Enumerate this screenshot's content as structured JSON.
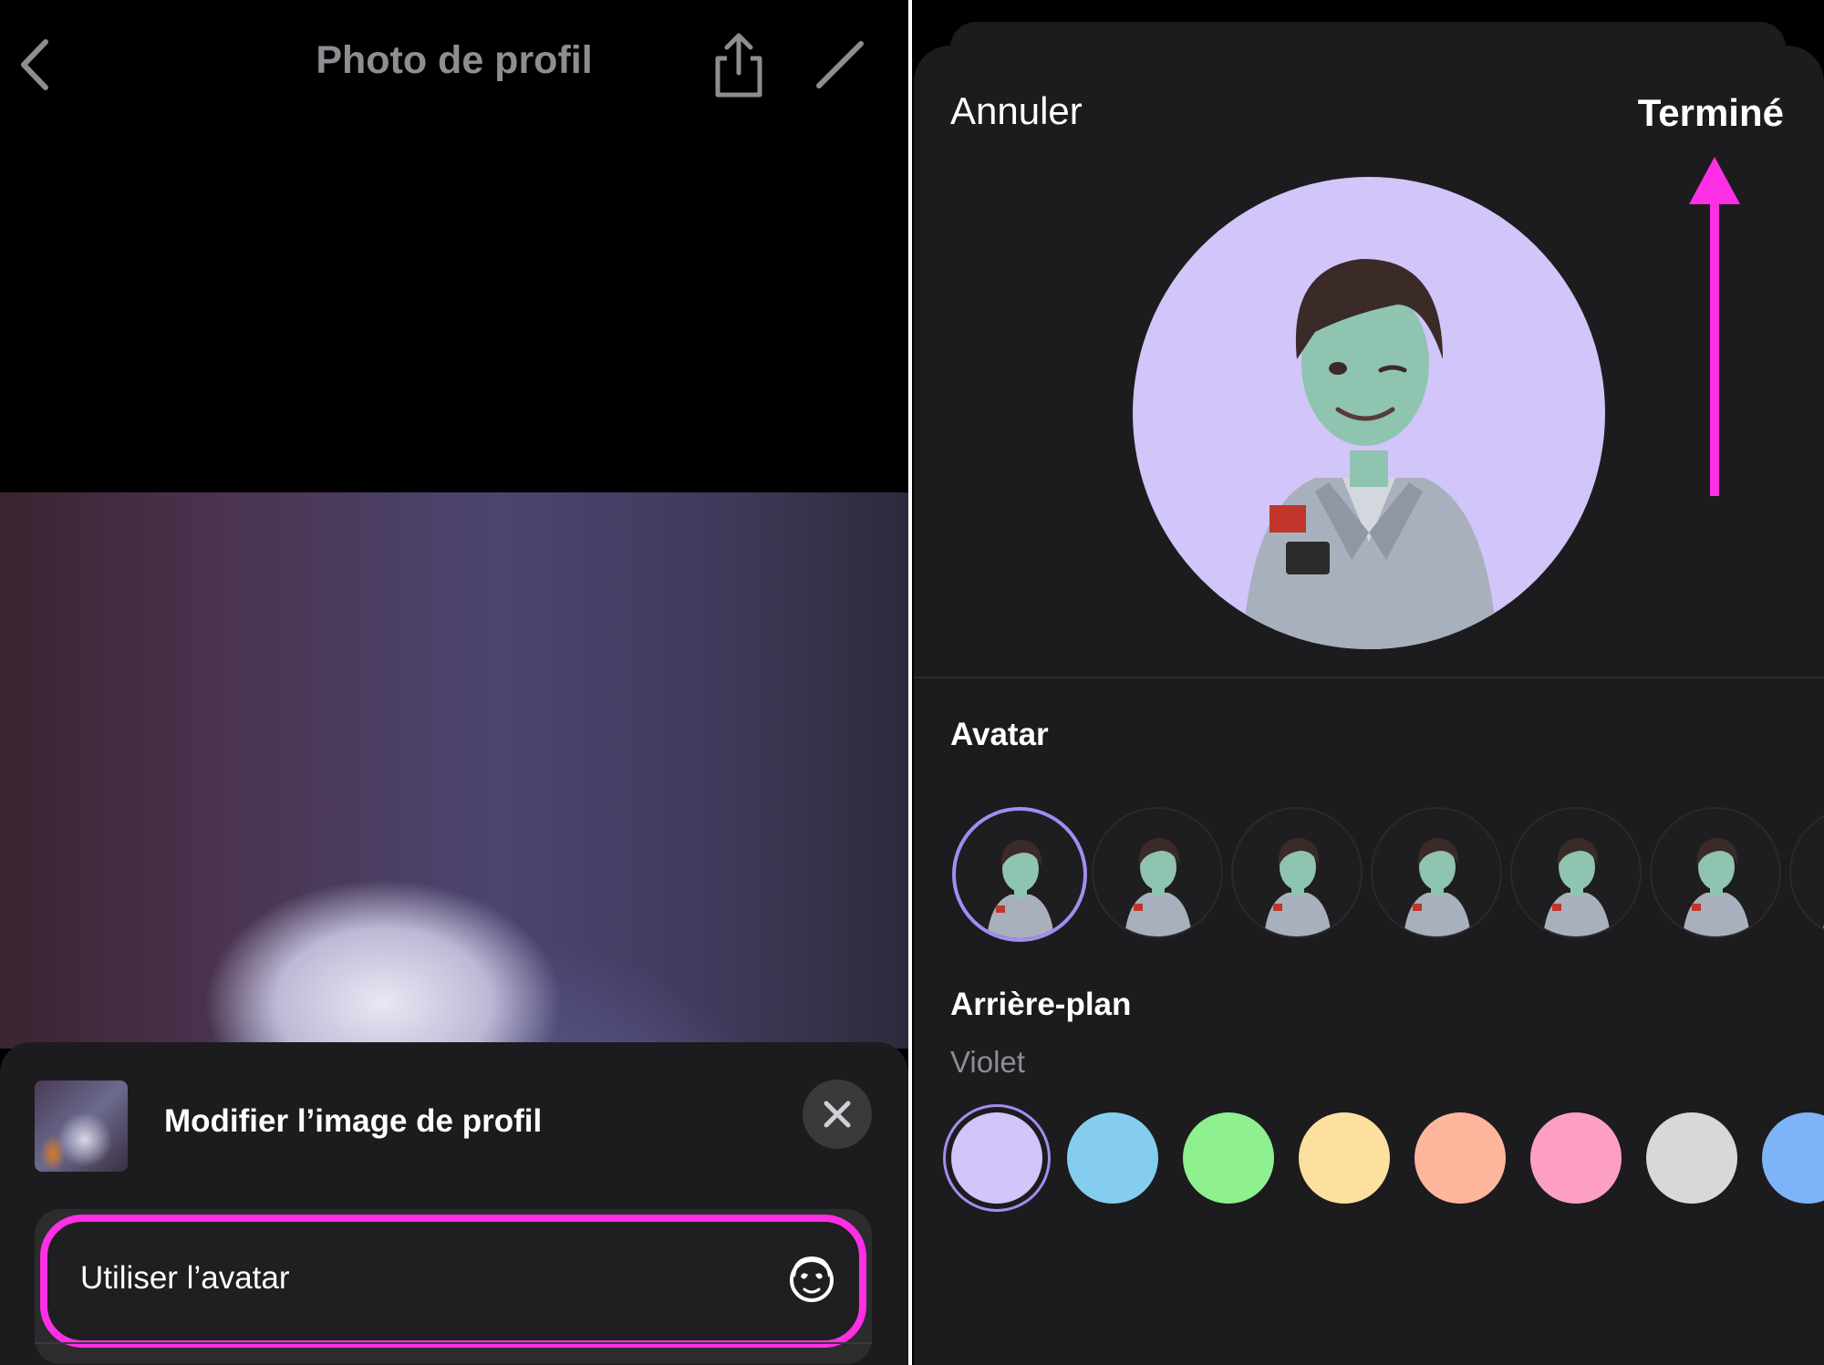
{
  "left_screen": {
    "header": {
      "title": "Photo de profil"
    },
    "sheet": {
      "title": "Modifier l’image de profil",
      "option_label": "Utiliser l’avatar"
    }
  },
  "right_screen": {
    "nav": {
      "cancel_label": "Annuler",
      "done_label": "Terminé"
    },
    "avatar_section": {
      "heading": "Avatar",
      "selected_index": 0,
      "pose_count": 7
    },
    "background_section": {
      "heading": "Arrière-plan",
      "selected_name": "Violet",
      "selected_index": 0,
      "swatches": [
        "#d1c5f9",
        "#84cdee",
        "#8ef08e",
        "#fde0a0",
        "#fdb69c",
        "#fd9fc4",
        "#d8d8d8",
        "#7db4f8"
      ]
    }
  },
  "colors": {
    "highlight": "#ff2fe6",
    "selection": "#a58cf0"
  },
  "icons": [
    "chevron-left-icon",
    "share-icon",
    "pencil-icon",
    "close-icon",
    "avatar-face-icon",
    "arrow-up-annotation"
  ]
}
